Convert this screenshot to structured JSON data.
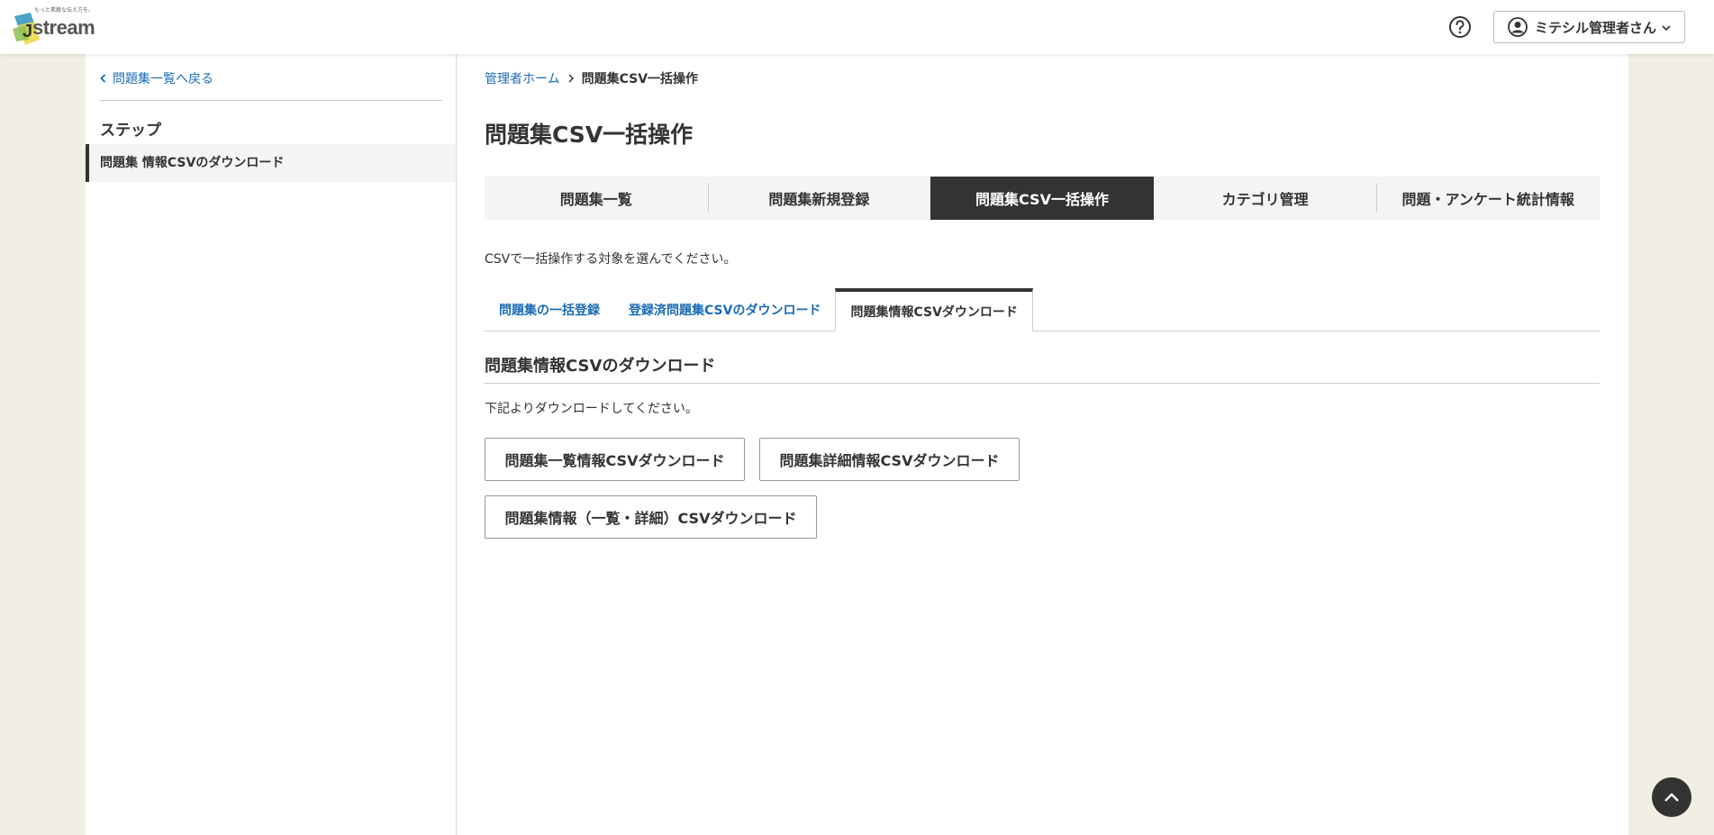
{
  "header": {
    "logo_tagline": "もっと素敵な伝え方を。",
    "logo_text": "stream",
    "user_name": "ミテシル管理者さん"
  },
  "sidebar": {
    "back_label": "問題集一覧へ戻る",
    "step_heading": "ステップ",
    "steps": [
      {
        "label": "問題集 情報CSVのダウンロード"
      }
    ]
  },
  "breadcrumb": {
    "home": "管理者ホーム",
    "current": "問題集CSV一括操作"
  },
  "page_title": "問題集CSV一括操作",
  "nav_tabs": [
    {
      "label": "問題集一覧"
    },
    {
      "label": "問題集新規登録"
    },
    {
      "label": "問題集CSV一括操作"
    },
    {
      "label": "カテゴリ管理"
    },
    {
      "label": "問題・アンケート統計情報"
    }
  ],
  "instruction": "CSVで一括操作する対象を選んでください。",
  "sub_tabs": [
    {
      "label": "問題集の一括登録"
    },
    {
      "label": "登録済問題集CSVのダウンロード"
    },
    {
      "label": "問題集情報CSVダウンロード"
    }
  ],
  "section": {
    "title": "問題集情報CSVのダウンロード",
    "description": "下記よりダウンロードしてください。"
  },
  "buttons": {
    "list_csv": "問題集一覧情報CSVダウンロード",
    "detail_csv": "問題集詳細情報CSVダウンロード",
    "all_csv": "問題集情報（一覧・詳細）CSVダウンロード"
  },
  "colors": {
    "accent_link": "#1a6bb5",
    "active_tab": "#333333",
    "background": "#f3eee4"
  },
  "icons": {
    "help": "help-circle-icon",
    "user": "user-circle-icon",
    "dropdown": "chevron-down-icon",
    "back": "chevron-left-icon",
    "breadcrumb_sep": "chevron-right-icon",
    "page_top": "chevron-up-icon"
  }
}
